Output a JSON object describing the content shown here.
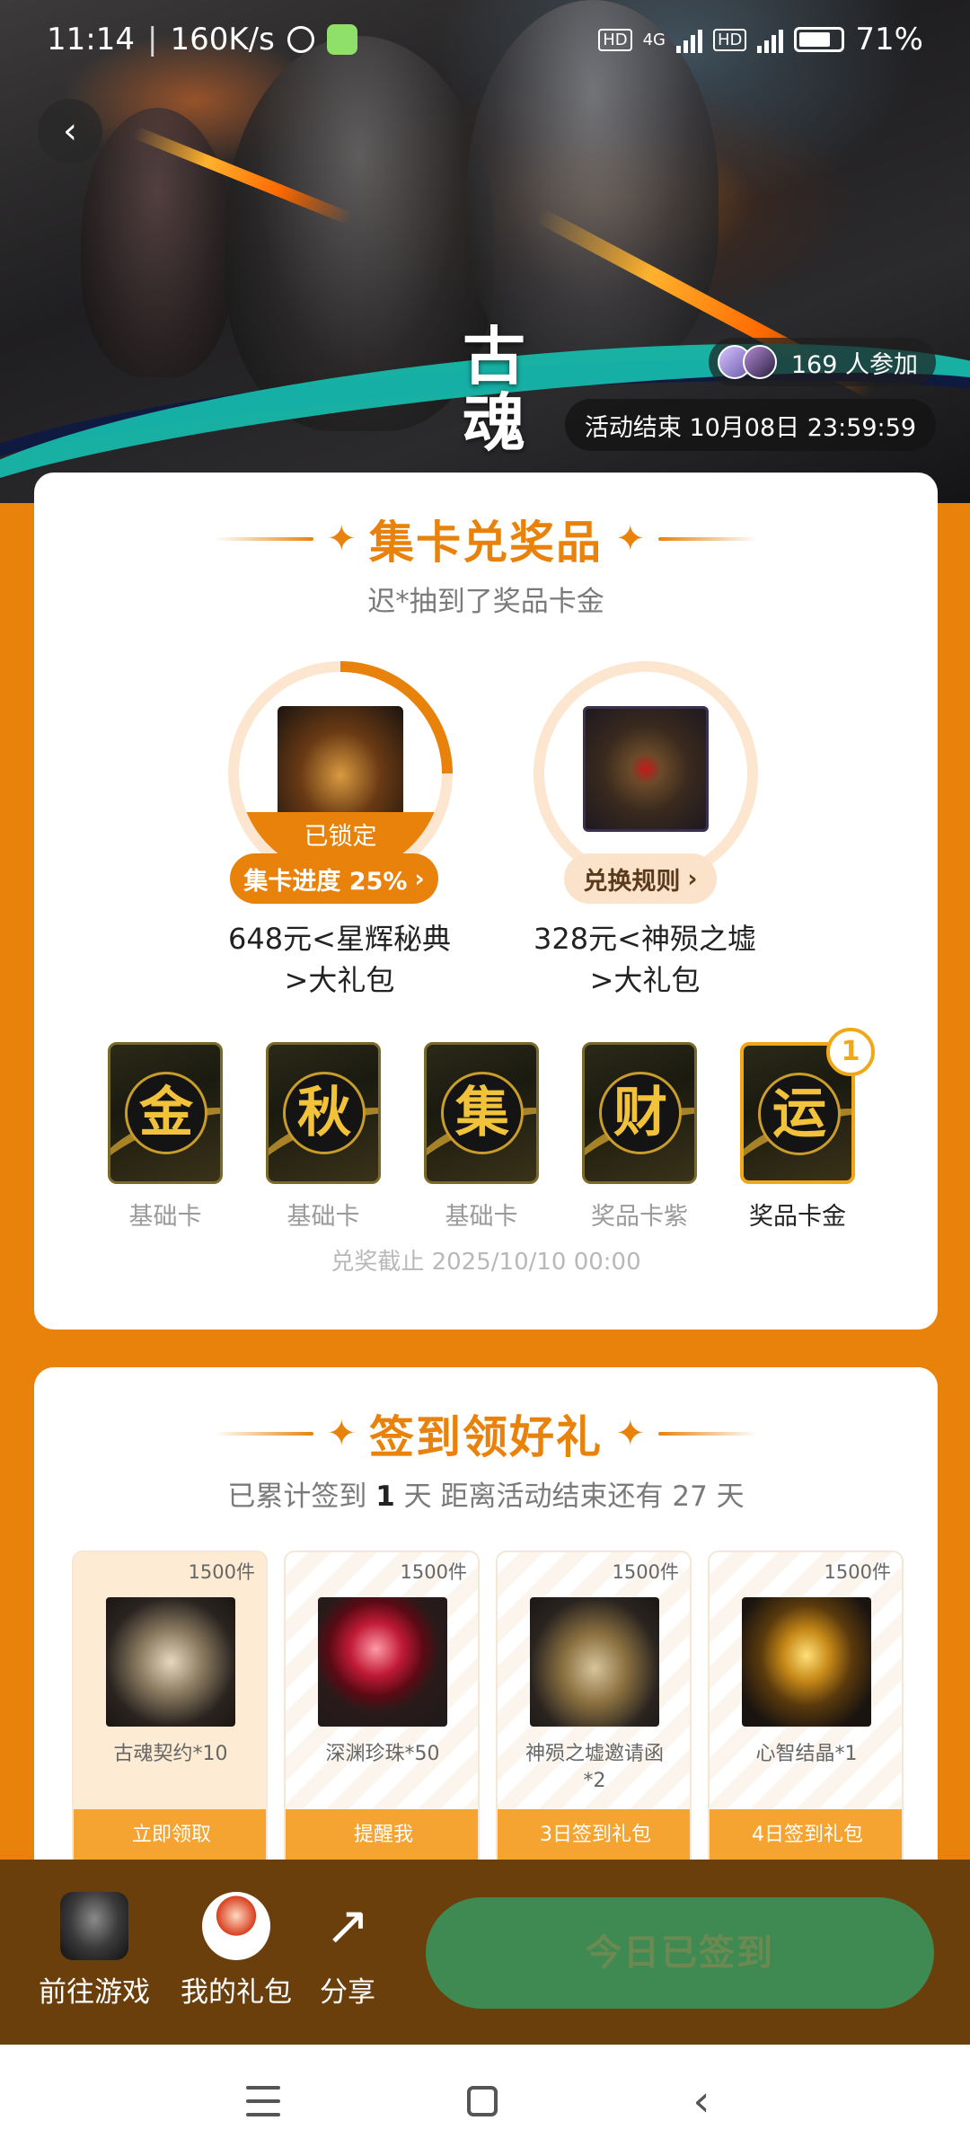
{
  "status_bar": {
    "time": "11:14",
    "net_speed": "160K/s",
    "network": "4G",
    "battery": "71%"
  },
  "hero": {
    "logo_text": "古魂",
    "participants": "169 人参加",
    "end_time": "活动结束 10月08日 23:59:59"
  },
  "card_collect": {
    "title": "集卡兑奖品",
    "subtitle": "迟*抽到了奖品卡金",
    "prize1": {
      "locked": "已锁定",
      "progress_label": "集卡进度 25%",
      "name_line1": "648元<星辉秘典",
      "name_line2": ">大礼包",
      "progress": 0.25
    },
    "prize2": {
      "rules_label": "兑换规则",
      "name_line1": "328元<神殒之墟",
      "name_line2": ">大礼包"
    },
    "cards": [
      {
        "char": "金",
        "label": "基础卡"
      },
      {
        "char": "秋",
        "label": "基础卡"
      },
      {
        "char": "集",
        "label": "基础卡"
      },
      {
        "char": "财",
        "label": "奖品卡紫"
      },
      {
        "char": "运",
        "label": "奖品卡金",
        "badge": "1"
      }
    ],
    "deadline": "兑奖截止 2025/10/10 00:00"
  },
  "signin": {
    "title": "签到领好礼",
    "sub_prefix": "已累计签到",
    "sub_days": "1",
    "sub_mid": "天  距离活动结束还有 27 天",
    "gifts": [
      {
        "qty": "1500件",
        "name": "古魂契约*10",
        "button": "立即领取"
      },
      {
        "qty": "1500件",
        "name": "深渊珍珠*50",
        "button": "提醒我"
      },
      {
        "qty": "1500件",
        "name": "神殒之墟邀请函\n*2",
        "button": "3日签到礼包"
      },
      {
        "qty": "1500件",
        "name": "心智结晶*1",
        "button": "4日签到礼包"
      }
    ]
  },
  "bottom_bar": {
    "go_game": "前往游戏",
    "my_gifts": "我的礼包",
    "share": "分享",
    "checked_in": "今日已签到"
  },
  "colors": {
    "accent": "#e8820a",
    "bottom_bar": "#6b3f0c",
    "checked_btn": "#3f8a52"
  }
}
